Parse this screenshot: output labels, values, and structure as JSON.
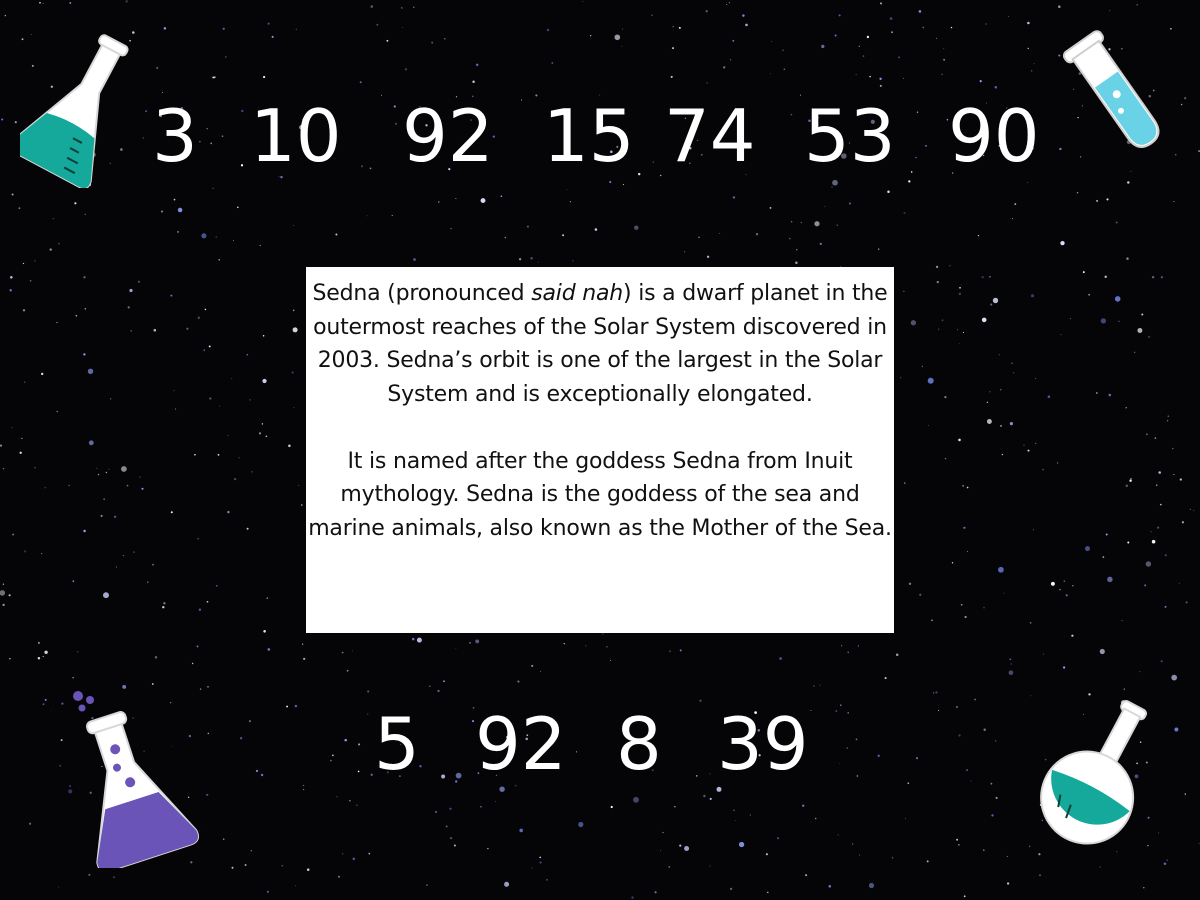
{
  "numbers_top": [
    "3",
    "10",
    "92",
    "15",
    "74",
    "53",
    "90"
  ],
  "numbers_bottom": [
    "5",
    "92",
    "8",
    "39"
  ],
  "info": {
    "p1_before": "Sedna (pronounced ",
    "p1_italic": "said nah",
    "p1_after": ") is a dwarf planet in the outermost reaches of the Solar System discovered in 2003. Sedna’s orbit is one of the largest in the Solar System and is exceptionally elongated.",
    "p2": "It is named after the goddess Sedna from Inuit mythology. Sedna is the goddess of the sea and marine animals, also known as the Mother of the Sea."
  },
  "icons": {
    "top_left": "erlenmeyer-flask-teal-icon",
    "top_right": "test-tube-blue-icon",
    "bottom_left": "erlenmeyer-flask-purple-icon",
    "bottom_right": "round-flask-teal-icon"
  },
  "colors": {
    "background": "#050507",
    "teal_liquid": "#14a99b",
    "blue_liquid": "#6ad2e6",
    "purple_liquid": "#6a54b8"
  }
}
